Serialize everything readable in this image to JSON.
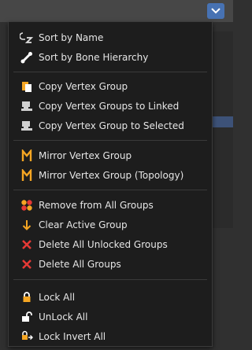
{
  "menu": {
    "items": [
      {
        "label": "Sort by Name",
        "icon": "sort-by-name-icon"
      },
      {
        "label": "Sort by Bone Hierarchy",
        "icon": "bone-icon"
      },
      {
        "label": "Copy Vertex Group",
        "icon": "copy-vertex-group-icon"
      },
      {
        "label": "Copy Vertex Groups to Linked",
        "icon": "copy-linked-icon"
      },
      {
        "label": "Copy Vertex Group to Selected",
        "icon": "copy-selected-icon"
      },
      {
        "label": "Mirror Vertex Group",
        "icon": "mirror-icon"
      },
      {
        "label": "Mirror Vertex Group (Topology)",
        "icon": "mirror-topology-icon"
      },
      {
        "label": "Remove from All Groups",
        "icon": "remove-all-groups-icon"
      },
      {
        "label": "Clear Active Group",
        "icon": "clear-active-icon"
      },
      {
        "label": "Delete All Unlocked Groups",
        "icon": "delete-unlocked-icon"
      },
      {
        "label": "Delete All Groups",
        "icon": "delete-all-icon"
      },
      {
        "label": "Lock All",
        "icon": "lock-icon"
      },
      {
        "label": "UnLock All",
        "icon": "unlock-icon"
      },
      {
        "label": "Lock Invert All",
        "icon": "lock-invert-icon"
      }
    ]
  },
  "colors": {
    "accent": "#4772b3",
    "menu_bg": "#1d1d1d",
    "delete_red": "#e53935",
    "icon_orange": "#f5a623"
  }
}
